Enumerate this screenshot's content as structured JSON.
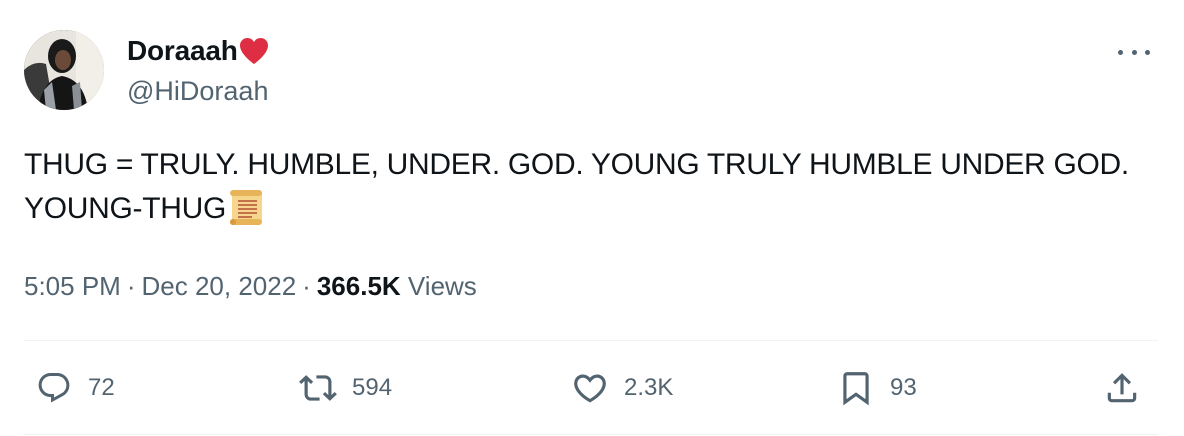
{
  "author": {
    "display_name": "Doraaah",
    "name_emoji": "red-heart-emoji",
    "handle": "@HiDoraah",
    "avatar": "profile-photo"
  },
  "tweet": {
    "text": "THUG = TRULY. HUMBLE, UNDER. GOD. YOUNG TRULY HUMBLE UNDER GOD. YOUNG-THUG",
    "trailing_emoji": "scroll-emoji",
    "time": "5:05 PM",
    "separator": "·",
    "date": "Dec 20, 2022",
    "views_count": "366.5K",
    "views_label": "Views"
  },
  "actions": {
    "replies": "72",
    "retweets": "594",
    "likes": "2.3K",
    "bookmarks": "93"
  },
  "icons": {
    "more": "more-icon",
    "reply": "reply-icon",
    "retweet": "retweet-icon",
    "like": "heart-icon",
    "bookmark": "bookmark-icon",
    "share": "share-icon"
  },
  "colors": {
    "text_primary": "#0f1419",
    "text_secondary": "#536471",
    "divider": "#eff3f4",
    "heart_red": "#dd2e44"
  }
}
